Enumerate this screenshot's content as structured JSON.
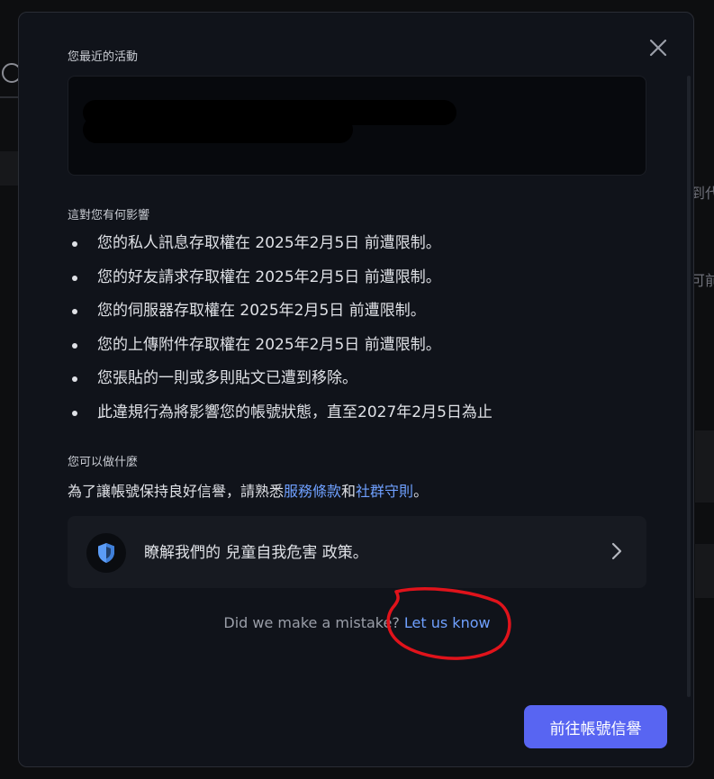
{
  "modal": {
    "recent_activity_title": "您最近的活動",
    "effects_title": "這對您有何影響",
    "effects": [
      "您的私人訊息存取權在 2025年2月5日 前遭限制。",
      "您的好友請求存取權在 2025年2月5日 前遭限制。",
      "您的伺服器存取權在 2025年2月5日 前遭限制。",
      "您的上傳附件存取權在 2025年2月5日 前遭限制。",
      "您張貼的一則或多則貼文已遭到移除。",
      "此違規行為將影響您的帳號狀態，直至2027年2月5日為止"
    ],
    "what_to_do_title": "您可以做什麼",
    "what_to_do": {
      "prefix": "為了讓帳號保持良好信譽，請熟悉",
      "terms_link": "服務條款",
      "and": "和",
      "guidelines_link": "社群守則",
      "suffix": "。"
    },
    "policy_card": {
      "text": "瞭解我們的 兒童自我危害 政策。",
      "icon": "shield-icon"
    },
    "mistake": {
      "text": "Did we make a mistake?",
      "link": "Let us know"
    },
    "primary_button": "前往帳號信譽",
    "close_icon": "close-icon"
  },
  "background": {
    "fragment_1": "到代",
    "fragment_2": "可前"
  },
  "colors": {
    "accent": "#5865f2",
    "link": "#6fa0ff",
    "annotation": "#e0131b",
    "modal_bg": "#10131a"
  }
}
